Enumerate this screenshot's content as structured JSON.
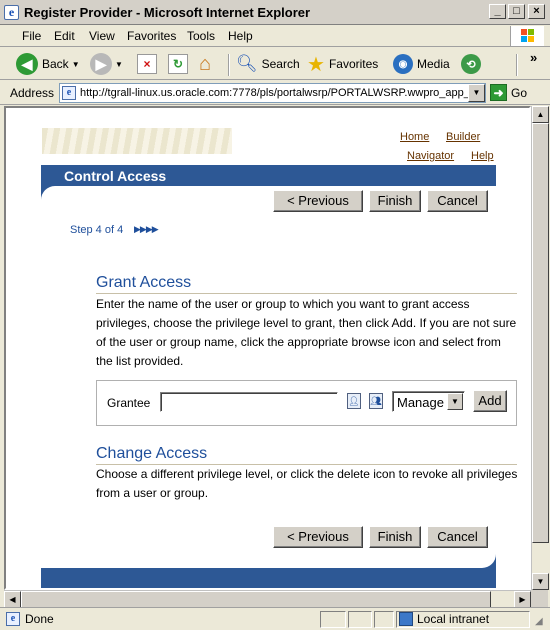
{
  "window": {
    "title": "Register Provider - Microsoft Internet Explorer",
    "controls": {
      "minimize": "_",
      "maximize": "□",
      "close": "×"
    }
  },
  "menu": [
    "File",
    "Edit",
    "View",
    "Favorites",
    "Tools",
    "Help"
  ],
  "toolbar": {
    "back": "Back",
    "search": "Search",
    "favorites": "Favorites",
    "media": "Media",
    "overflow": "»"
  },
  "address": {
    "label": "Address",
    "url": "http://tgrall-linux.us.oracle.com:7778/pls/portalwsrp/PORTALWSRP.wwpro_app_",
    "go": "Go"
  },
  "portal": {
    "links": {
      "home": "Home",
      "builder": "Builder",
      "navigator": "Navigator",
      "help": "Help"
    },
    "title": "Control Access",
    "buttons": {
      "previous": "< Previous",
      "finish": "Finish",
      "cancel": "Cancel"
    },
    "step": "Step 4 of 4",
    "step_arrows": "▶▶▶▶",
    "grant": {
      "heading": "Grant Access",
      "description": "Enter the name of the user or group to which you want to grant access privileges, choose the privilege level to grant, then click Add. If you are not sure of the user or group name, click the appropriate browse icon and select from the list provided.",
      "grantee_label": "Grantee",
      "grantee_value": "",
      "privilege": "Manage",
      "add": "Add"
    },
    "change": {
      "heading": "Change Access",
      "description": "Choose a different privilege level, or click the delete icon to revoke all privileges from a user or group."
    }
  },
  "status": {
    "text": "Done",
    "zone": "Local intranet"
  },
  "colors": {
    "banner": "#2d5895",
    "heading": "#1f4f9b",
    "link": "#663300"
  }
}
